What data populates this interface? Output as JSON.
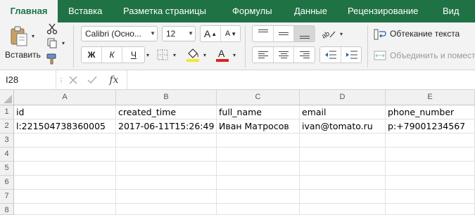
{
  "ribbon_tabs": [
    "Главная",
    "Вставка",
    "Разметка страницы",
    "Формулы",
    "Данные",
    "Рецензирование",
    "Вид"
  ],
  "clipboard": {
    "paste_label": "Вставить"
  },
  "font": {
    "family": "Calibri (Осно...",
    "size": "12",
    "bold": "Ж",
    "italic": "К",
    "underline": "Ч",
    "grow": "A",
    "shrink": "A",
    "color_letter": "A"
  },
  "alignment": {
    "wrap_text": "Обтекание текста",
    "merge_center": "Объединить и поместить"
  },
  "formula_bar": {
    "name_box": "I28",
    "fx": "fx",
    "formula": ""
  },
  "sheet": {
    "columns": [
      "A",
      "B",
      "C",
      "D",
      "E"
    ],
    "rows": [
      "1",
      "2",
      "3",
      "4",
      "5",
      "6",
      "7",
      "8"
    ],
    "cells": [
      [
        "id",
        "created_time",
        "full_name",
        "email",
        "phone_number"
      ],
      [
        "l:221504738360005",
        "2017-06-11T15:26:49",
        "Иван Матросов",
        "ivan@tomato.ru",
        "p:+79001234567"
      ],
      [
        "",
        "",
        "",
        "",
        ""
      ],
      [
        "",
        "",
        "",
        "",
        ""
      ],
      [
        "",
        "",
        "",
        "",
        ""
      ],
      [
        "",
        "",
        "",
        "",
        ""
      ],
      [
        "",
        "",
        "",
        "",
        ""
      ],
      [
        "",
        "",
        "",
        "",
        ""
      ]
    ]
  },
  "colors": {
    "ribbon_green": "#1f7244",
    "font_color_bar": "#e02020",
    "highlight_bar": "#f5e82a"
  }
}
